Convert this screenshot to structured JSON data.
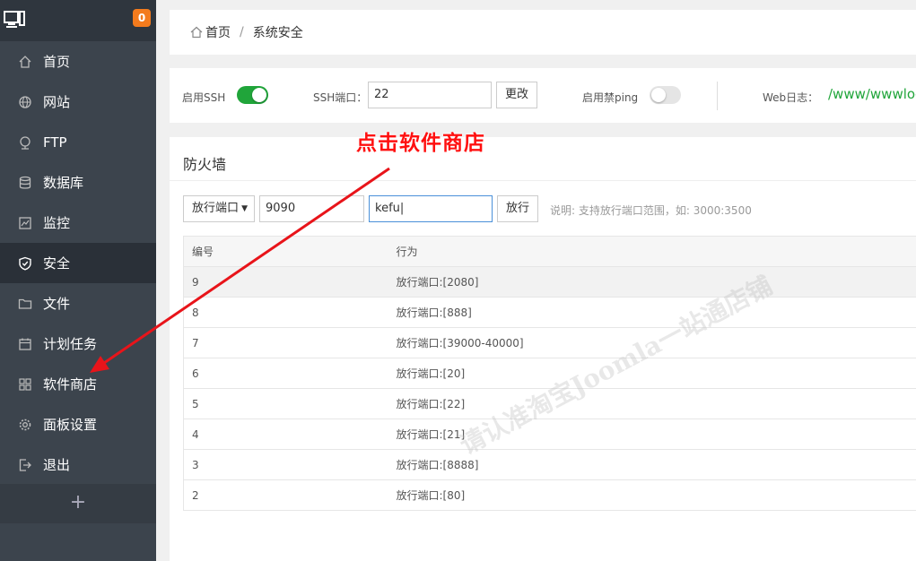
{
  "sidebar": {
    "badge": "0",
    "items": [
      {
        "label": "首页",
        "icon": "home-icon"
      },
      {
        "label": "网站",
        "icon": "globe-icon"
      },
      {
        "label": "FTP",
        "icon": "ftp-icon"
      },
      {
        "label": "数据库",
        "icon": "database-icon"
      },
      {
        "label": "监控",
        "icon": "monitor-chart-icon"
      },
      {
        "label": "安全",
        "icon": "shield-icon",
        "active": true
      },
      {
        "label": "文件",
        "icon": "folder-icon"
      },
      {
        "label": "计划任务",
        "icon": "calendar-icon"
      },
      {
        "label": "软件商店",
        "icon": "grid-icon"
      },
      {
        "label": "面板设置",
        "icon": "gear-icon"
      },
      {
        "label": "退出",
        "icon": "logout-icon"
      }
    ],
    "add": "+"
  },
  "breadcrumb": {
    "home": "首页",
    "separator": "/",
    "current": "系统安全"
  },
  "ssh": {
    "enable_label": "启用SSH",
    "enabled": true,
    "port_label": "SSH端口：",
    "port_value": "22",
    "change_button": "更改",
    "ping_label": "启用禁ping",
    "ping_enabled": false,
    "weblog_label": "Web日志：",
    "weblog_path": "/www/wwwlog"
  },
  "firewall": {
    "title": "防火墙",
    "type_select": "放行端口",
    "port_input": "9090",
    "remark_input": "kefu",
    "allow_button": "放行",
    "hint": "说明: 支持放行端口范围，如: 3000:3500",
    "columns": [
      "编号",
      "行为"
    ],
    "rows": [
      {
        "id": "9",
        "action": "放行端口:[2080]"
      },
      {
        "id": "8",
        "action": "放行端口:[888]"
      },
      {
        "id": "7",
        "action": "放行端口:[39000-40000]"
      },
      {
        "id": "6",
        "action": "放行端口:[20]"
      },
      {
        "id": "5",
        "action": "放行端口:[22]"
      },
      {
        "id": "4",
        "action": "放行端口:[21]"
      },
      {
        "id": "3",
        "action": "放行端口:[8888]"
      },
      {
        "id": "2",
        "action": "放行端口:[80]"
      }
    ]
  },
  "annotation": "点击软件商店",
  "watermark": "请认准淘宝Joomla一站通店铺",
  "colors": {
    "accent_green": "#20a53a",
    "badge_orange": "#f37b1d",
    "annotation_red": "#ff1010",
    "sidebar_bg": "#3c444d"
  }
}
